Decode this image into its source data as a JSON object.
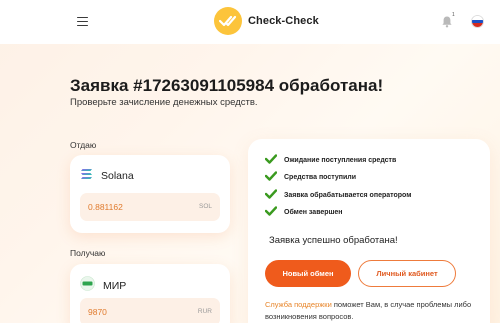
{
  "header": {
    "logo_text": "Check-Check",
    "notification_count": "1"
  },
  "page": {
    "title": "Заявка #17263091105984 обработана!",
    "subtitle": "Проверьте зачисление денежных средств."
  },
  "give": {
    "label": "Отдаю",
    "coin_name": "Solana",
    "coin_icon": "solana-icon",
    "amount": "0.881162",
    "currency": "SOL"
  },
  "receive": {
    "label": "Получаю",
    "coin_name": "МИР",
    "coin_icon": "mir-card-icon",
    "amount": "9870",
    "currency": "RUR"
  },
  "status": {
    "steps": [
      "Ожидание поступления средств",
      "Средства поступили",
      "Заявка обрабатывается оператором",
      "Обмен завершен"
    ],
    "done_message": "Заявка успешно обработана!",
    "new_exchange_button": "Новый обмен",
    "cabinet_button": "Личный кабинет",
    "support_link": "Служба поддержки",
    "support_text": " поможет Вам, в случае проблемы либо возникновения вопросов."
  },
  "colors": {
    "accent": "#ef5b1c",
    "check": "#3a9a1f",
    "amount": "#e07b2e",
    "logo": "#fcc43b"
  }
}
